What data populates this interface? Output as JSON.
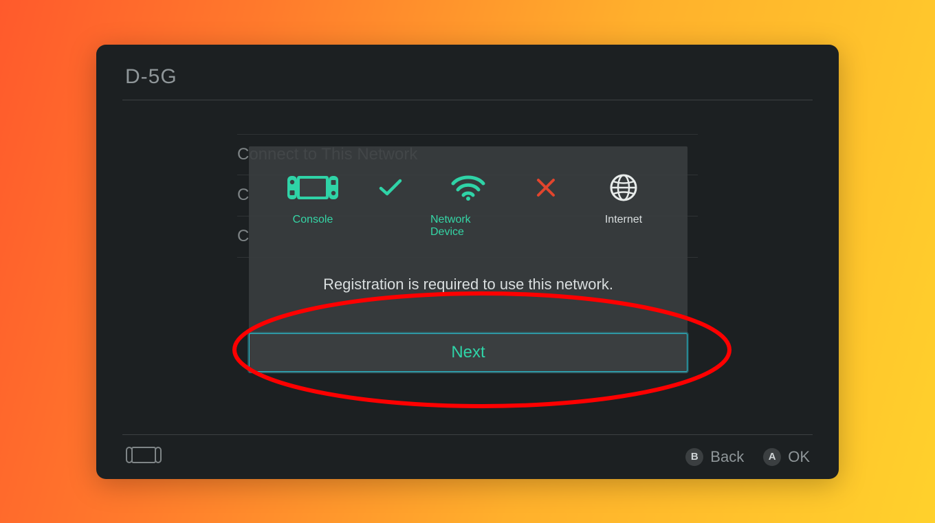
{
  "header": {
    "title": "D-5G"
  },
  "background_list": {
    "items": [
      {
        "label": "Connect to This Network"
      },
      {
        "label": "C"
      },
      {
        "label": "C"
      }
    ]
  },
  "modal": {
    "icons": {
      "console_label": "Console",
      "network_device_label": "Network Device",
      "internet_label": "Internet"
    },
    "connection": {
      "console_to_router": "ok",
      "router_to_internet": "fail"
    },
    "message": "Registration is required to use this network.",
    "next_label": "Next"
  },
  "footer": {
    "back_label": "Back",
    "ok_label": "OK",
    "back_key": "B",
    "ok_key": "A"
  },
  "colors": {
    "accent_teal": "#2fd3a7",
    "accent_cyan": "#2bb9c9",
    "error_red": "#e2452d",
    "panel": "#1c2022",
    "annotation_red": "#ff0000"
  },
  "annotation": {
    "highlights": "next-button"
  }
}
